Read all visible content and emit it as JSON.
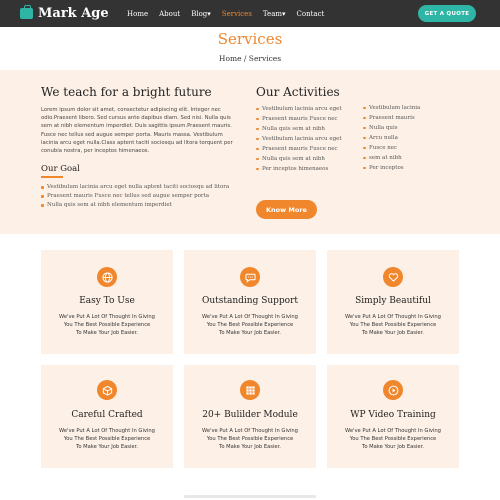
{
  "header": {
    "brand": "Mark Age",
    "nav": [
      "Home",
      "About",
      "Blog",
      "Services",
      "Team",
      "Contact"
    ],
    "cta": "GET A QUOTE",
    "accent": "#f0872d",
    "brand_color": "#2fb5a5",
    "bar_color": "#333333"
  },
  "title": {
    "heading": "Services",
    "breadcrumb": "Home / Services"
  },
  "about": {
    "heading": "We teach for a bright future",
    "paragraph": "Lorem ipsum dolor sit amet, consectetur adipiscing elit. Integer nec odio.Praesent libero. Sed cursus ante dapibus diam. Sed nisi. Nulla quis sem at nibh elementum imperdiet. Duis sagittis ipsum.Praesent mauris. Fusce nec tellus sed augue semper porta. Mauris massa. Vestibulum lacinia arcu eget nulla.Class aptent taciti sociosqu ad litora torquent per conubia nostra, per inceptos himenaeos.",
    "goal_title": "Our Goal",
    "goals": [
      "Vestibulum lacinia arcu eget nulla aptent taciti sociosqu ad litora",
      "Praesent mauris Fusce nec tellus sed augue semper porta",
      "Nulla quis sem at nibh elementum imperdiet"
    ]
  },
  "activities": {
    "heading": "Our Activities",
    "col1": [
      "Vestibulum lacinia arcu eget",
      "Praesent mauris Fusce nec",
      "Nulla quis sem at nibh",
      "Vestibulum lacinia arcu eget",
      "Praesent mauris Fusce nec",
      "Nulla quis sem at nibh",
      "Per inceptos himenaeos"
    ],
    "col2": [
      "Vestibulum lacinia",
      "Praesent mauris",
      "Nulla quis",
      "Arcu nulla",
      "Fusce nec",
      "sem at nibh",
      "Per inceptos"
    ],
    "button": "Know More"
  },
  "cards": [
    {
      "title": "Easy To Use",
      "icon": "globe-icon",
      "desc": [
        "We've Put A Lot Of Thought In Giving",
        "You The Best Possible Experience",
        "To Make Your Job Easier."
      ]
    },
    {
      "title": "Outstanding Support",
      "icon": "chat-icon",
      "desc": [
        "We've Put A Lot Of Thought In Giving",
        "You The Best Possible Experience",
        "To Make Your Job Easier."
      ]
    },
    {
      "title": "Simply Beautiful",
      "icon": "heart-icon",
      "desc": [
        "We've Put A Lot Of Thought In Giving",
        "You The Best Possible Experience",
        "To Make Your Job Easier."
      ]
    },
    {
      "title": "Careful Crafted",
      "icon": "cube-icon",
      "desc": [
        "We've Put A Lot Of Thought In Giving",
        "You The Best Possible Experience",
        "To Make Your Job Easier."
      ]
    },
    {
      "title": "20+ Bulilder Module",
      "icon": "grid-icon",
      "desc": [
        "We've Put A Lot Of Thought In Giving",
        "You The Best Possible Experience",
        "To Make Your Job Easier."
      ]
    },
    {
      "title": "WP Video Training",
      "icon": "play-icon",
      "desc": [
        "We've Put A Lot Of Thought In Giving",
        "You The Best Possible Experience",
        "To Make Your Job Easier."
      ]
    }
  ]
}
